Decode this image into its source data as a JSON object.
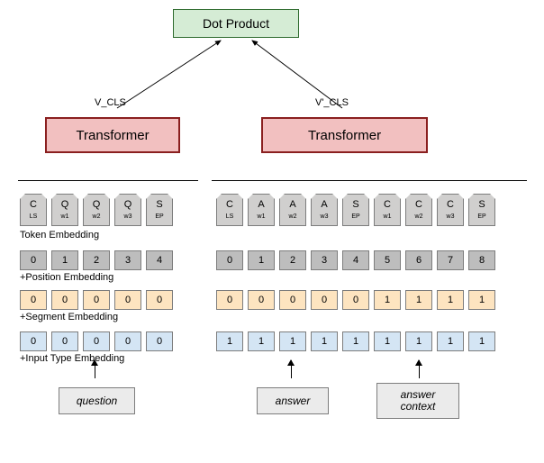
{
  "top": {
    "dot": "Dot Product",
    "vleft": "V_CLS",
    "vright": "V'_CLS",
    "xfmr": "Transformer"
  },
  "left": {
    "tokens": [
      {
        "t": "C",
        "b": "LS"
      },
      {
        "t": "Q",
        "b": "w1"
      },
      {
        "t": "Q",
        "b": "w2"
      },
      {
        "t": "Q",
        "b": "w3"
      },
      {
        "t": "S",
        "b": "EP"
      }
    ],
    "pos": [
      "0",
      "1",
      "2",
      "3",
      "4"
    ],
    "seg": [
      "0",
      "0",
      "0",
      "0",
      "0"
    ],
    "typ": [
      "0",
      "0",
      "0",
      "0",
      "0"
    ]
  },
  "right": {
    "tokens": [
      {
        "t": "C",
        "b": "LS"
      },
      {
        "t": "A",
        "b": "w1"
      },
      {
        "t": "A",
        "b": "w2"
      },
      {
        "t": "A",
        "b": "w3"
      },
      {
        "t": "S",
        "b": "EP"
      },
      {
        "t": "C",
        "b": "w1"
      },
      {
        "t": "C",
        "b": "w2"
      },
      {
        "t": "C",
        "b": "w3"
      },
      {
        "t": "S",
        "b": "EP"
      }
    ],
    "pos": [
      "0",
      "1",
      "2",
      "3",
      "4",
      "5",
      "6",
      "7",
      "8"
    ],
    "seg": [
      "0",
      "0",
      "0",
      "0",
      "0",
      "1",
      "1",
      "1",
      "1"
    ],
    "typ": [
      "1",
      "1",
      "1",
      "1",
      "1",
      "1",
      "1",
      "1",
      "1"
    ]
  },
  "labels": {
    "tok": "Token Embedding",
    "pos": "+Position Embedding",
    "seg": "+Segment Embedding",
    "typ": "+Input Type Embedding"
  },
  "inputs": {
    "q": "question",
    "a": "answer",
    "c": "answer context"
  }
}
